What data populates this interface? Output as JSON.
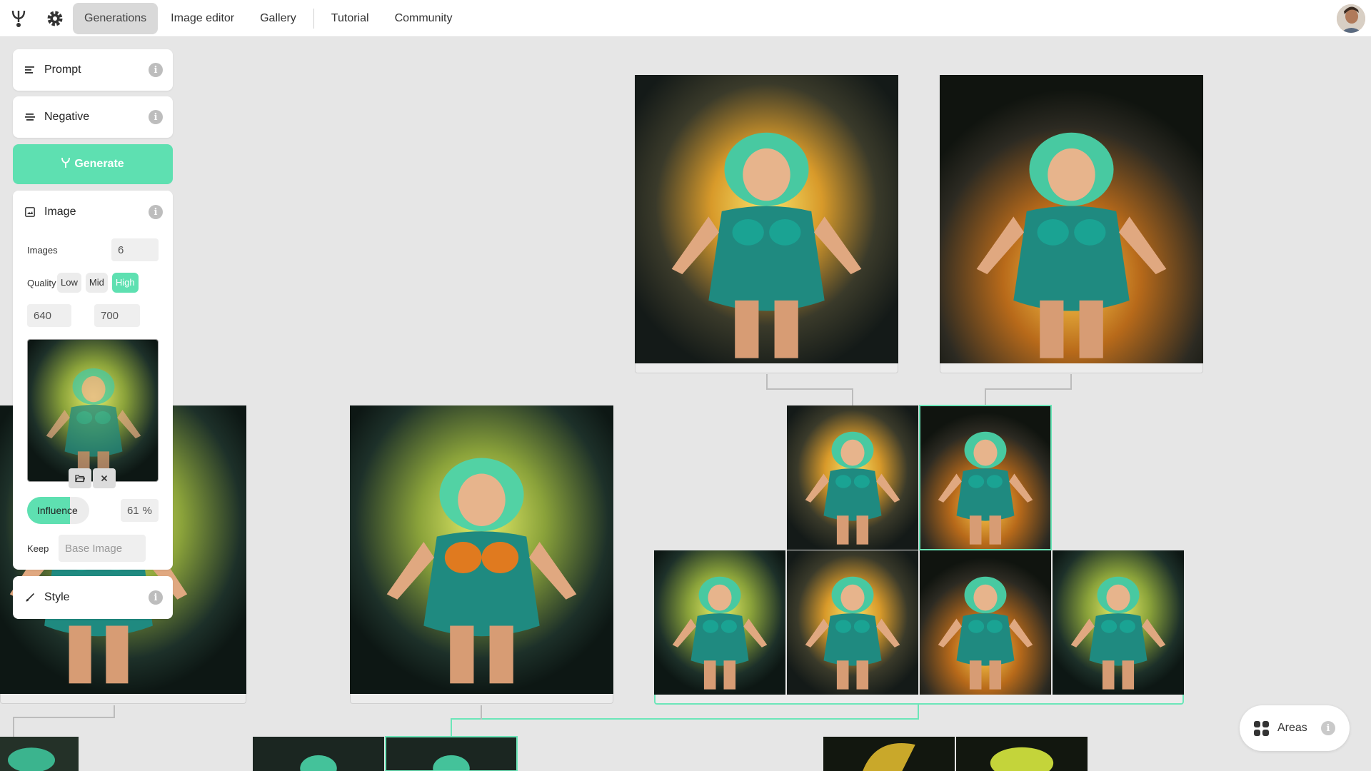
{
  "nav": {
    "tabs": [
      {
        "label": "Generations",
        "active": true
      },
      {
        "label": "Image editor",
        "active": false
      },
      {
        "label": "Gallery",
        "active": false
      },
      {
        "label": "Tutorial",
        "active": false
      },
      {
        "label": "Community",
        "active": false
      }
    ]
  },
  "sidebar": {
    "prompt_label": "Prompt",
    "negative_label": "Negative",
    "generate_label": "Generate",
    "image_section_label": "Image",
    "images_label": "Images",
    "images_value": "6",
    "quality_label": "Quality",
    "quality_options": [
      "Low",
      "Mid",
      "High"
    ],
    "quality_selected": "High",
    "width_value": "640",
    "height_value": "700",
    "influence_label": "Influence",
    "influence_value": "61",
    "influence_unit": "%",
    "keep_label": "Keep",
    "keep_placeholder": "Base Image",
    "style_label": "Style"
  },
  "areas": {
    "label": "Areas"
  },
  "colors": {
    "accent": "#5ee0b1",
    "canvas_bg": "#e6e6e6",
    "selection_line": "#6ce6b9"
  },
  "icons": {
    "logo": "fork-icon",
    "settings": "gear-icon",
    "prompt": "lines-icon",
    "negative": "strikethrough-icon",
    "image": "image-icon",
    "style": "brush-icon",
    "info": "info-icon",
    "open": "folder-open-icon",
    "remove": "close-icon",
    "areas": "grid-icon"
  }
}
